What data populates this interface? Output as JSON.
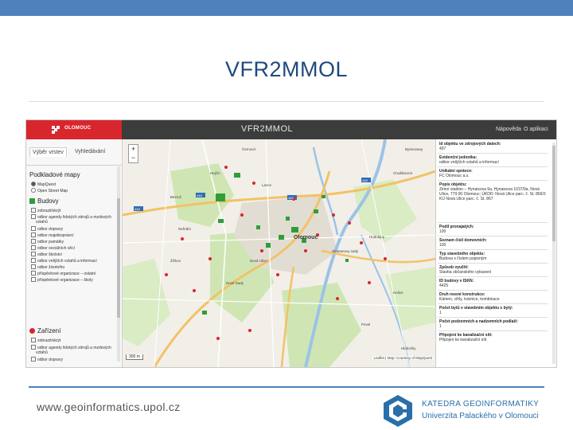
{
  "slide": {
    "title": "VFR2MMOL",
    "footer_url": "www.geoinformatics.upol.cz",
    "dept_line1": "KATEDRA GEOINFORMATIKY",
    "dept_line2": "Univerzita Palackého v Olomouci"
  },
  "app": {
    "logo_text": "OLOMOUC",
    "title": "VFR2MMOL",
    "nav": [
      "Nápověda",
      "O aplikaci"
    ]
  },
  "sidebar": {
    "tabs": [
      "Výběr vrstev",
      "Vyhledávání"
    ],
    "basemaps_title": "Podkladové mapy",
    "basemaps": [
      "MapQuest",
      "Open Street Map"
    ],
    "budovy_title": "Budovy",
    "budovy_items": [
      "zobrazit/skrýt",
      "odbor agendy lidských zdrojů a mzdových",
      "odbor dopravy",
      "odbor majetkoprávní",
      "odbor památky",
      "odbor sociálních věcí",
      "odbor školství",
      "odbor vnějších vztahů a informací",
      "odbor životního",
      "příspěvkové organizace – ostatní",
      "příspěvkové organizace – školy"
    ],
    "budovy_subline": "vztahů",
    "zarizeni_title": "Zařízení",
    "zarizeni_items": [
      "zobrazit/skrýt",
      "odbor agendy lidských zdrojů a mzdových",
      "odbor dopravy"
    ],
    "zarizeni_subline": "vztahů"
  },
  "map": {
    "city_label": "Olomouc",
    "scale": "300 m",
    "attribution": "Leaflet | Map: Courtesy of MapQuest",
    "labels": [
      "Bezruč",
      "Žižkov",
      "Smetanovy sady",
      "Černovír",
      "Nové Sady",
      "Hodolany",
      "Hejčín",
      "Lazce",
      "Chválkovice",
      "Nová Ulice",
      "Neředín",
      "Povel",
      "Bystrovany",
      "Holice",
      "Hlubočky"
    ],
    "road_badges": [
      "448",
      "446",
      "448",
      "446"
    ]
  },
  "info": {
    "rows": [
      {
        "label": "Id objektu ve zdrojových datech:",
        "value": "497"
      },
      {
        "label": "Evidenční jednotka:",
        "value": "odbor vnějších vztahů a informací"
      },
      {
        "label": "Unikátní správce:",
        "value": "FC Olomouc a.s."
      },
      {
        "label": "Popis objektu:",
        "value": "Zimní stadion – Hynaisova 9a, Hynaisova 1037/9a, Nová Ulice, 779 00 Olomouc; ÚKDD: Nová Ulice parc. č. St. 866/3 KÚ Nová Ulice parc. č. St. 867"
      },
      {
        "label": "Podíl pronajatých:",
        "value": "100"
      },
      {
        "label": "Seznam číslí domovních:",
        "value": "100"
      },
      {
        "label": "Typ stavebního objektu:",
        "value": "Budova s číslem popisným"
      },
      {
        "label": "Způsob využití:",
        "value": "Stavba občanského vybavení"
      },
      {
        "label": "ID budovy v ISKN:",
        "value": "4425"
      },
      {
        "label": "Druh nosné konstrukce:",
        "value": "Kámen, cihly, tvárnice, kombinace"
      },
      {
        "label": "Počet bytů v stavebním objektu s bytý:",
        "value": "1"
      },
      {
        "label": "Počet podzemních a nadzemních podlaží:",
        "value": "1"
      },
      {
        "label": "Připojení ke kanalizační síti:",
        "value": "Připojen ke kanalizační síti"
      }
    ]
  }
}
